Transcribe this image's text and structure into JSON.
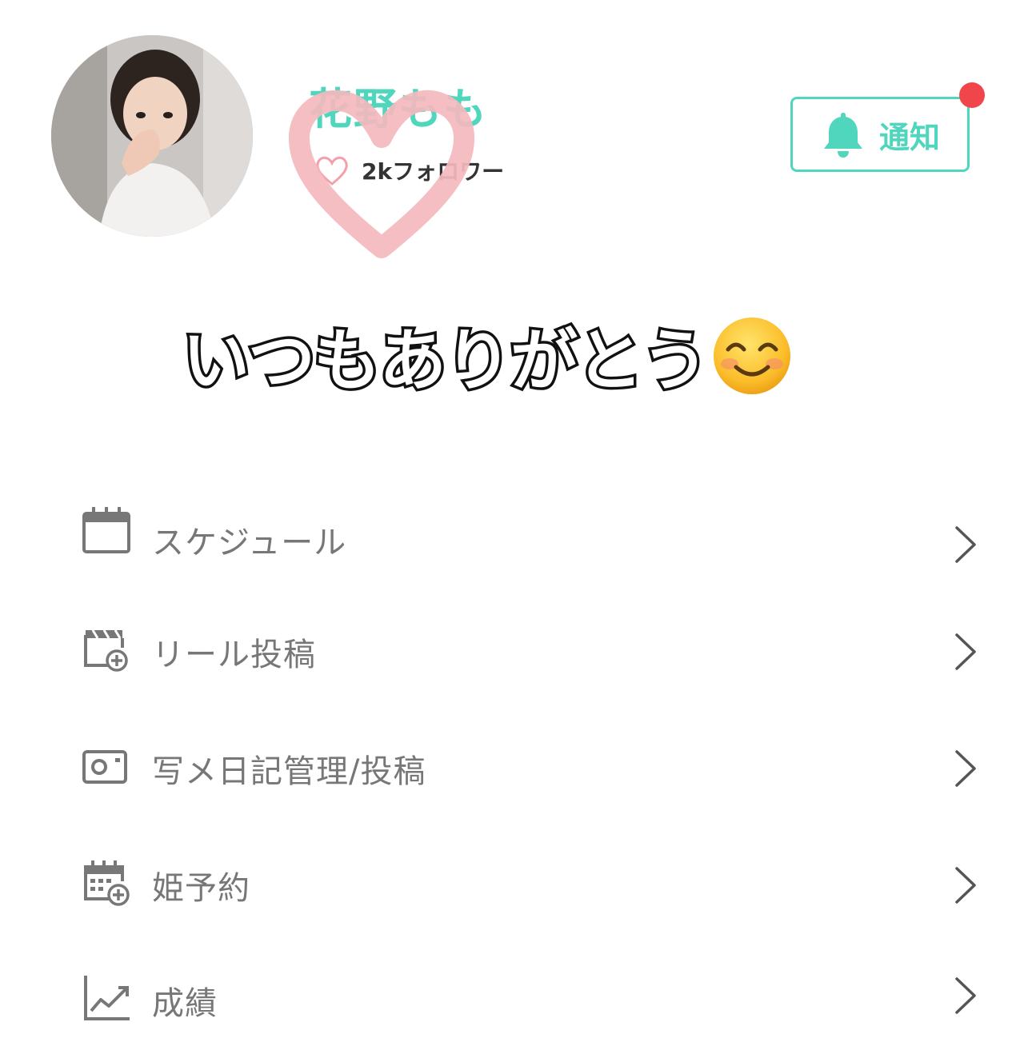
{
  "profile": {
    "name": "花野もも",
    "followers_label": "2kフォロワー"
  },
  "header": {
    "notify_label": "通知",
    "has_unread": true
  },
  "banner": {
    "message": "いつもありがとう"
  },
  "menu": {
    "items": [
      {
        "label": "スケジュール",
        "icon": "calendar-icon"
      },
      {
        "label": "リール投稿",
        "icon": "video-add-icon"
      },
      {
        "label": "写メ日記管理/投稿",
        "icon": "photo-icon"
      },
      {
        "label": "姫予約",
        "icon": "calendar-add-icon"
      },
      {
        "label": "成績",
        "icon": "chart-icon"
      }
    ]
  },
  "colors": {
    "accent": "#4fd6bd",
    "badge": "#f0454b",
    "menu_text": "#777777",
    "heart_overlay": "#f4b8bd"
  }
}
